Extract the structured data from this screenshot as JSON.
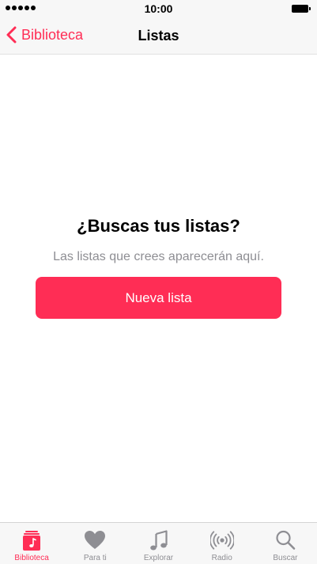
{
  "status_bar": {
    "time": "10:00",
    "signal_icon": "signal-dots-icon",
    "battery_icon": "battery-icon"
  },
  "nav": {
    "back_label": "Biblioteca",
    "title": "Listas",
    "back_icon": "chevron-left-icon"
  },
  "empty_state": {
    "title": "¿Buscas tus listas?",
    "subtitle": "Las listas que crees aparecerán aquí.",
    "button_label": "Nueva lista"
  },
  "tabs": [
    {
      "label": "Biblioteca",
      "icon": "library-icon",
      "active": true
    },
    {
      "label": "Para ti",
      "icon": "heart-icon",
      "active": false
    },
    {
      "label": "Explorar",
      "icon": "music-note-icon",
      "active": false
    },
    {
      "label": "Radio",
      "icon": "radio-broadcast-icon",
      "active": false
    },
    {
      "label": "Buscar",
      "icon": "search-icon",
      "active": false
    }
  ],
  "colors": {
    "accent": "#ff2d55",
    "inactive": "#8e8e93",
    "bar_background": "#f7f7f7"
  }
}
